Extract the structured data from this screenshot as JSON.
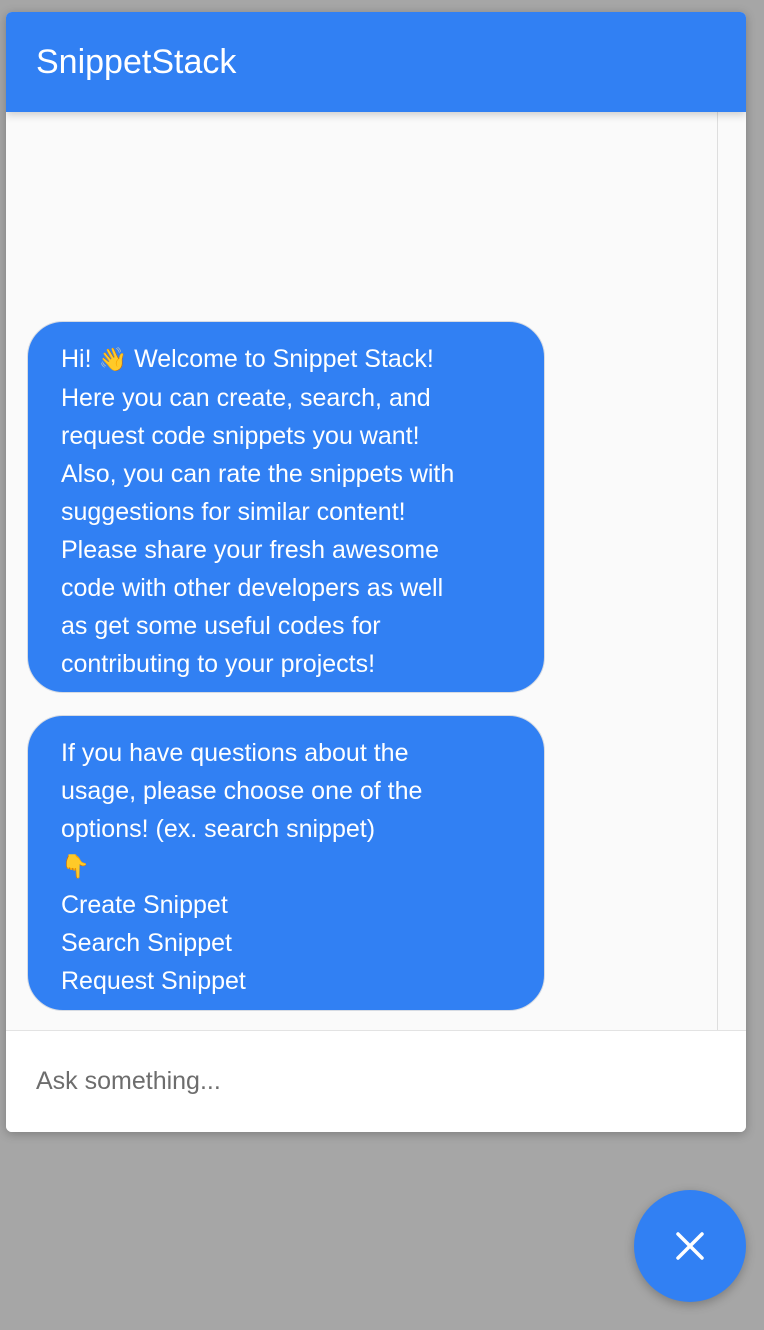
{
  "header": {
    "title": "SnippetStack"
  },
  "messages": [
    {
      "lines": [
        {
          "prefix": "Hi! ",
          "emoji": "👋",
          "suffix": " Welcome to Snippet Stack!"
        },
        {
          "text": "Here you can create, search, and"
        },
        {
          "text": "request code snippets you want!"
        },
        {
          "text": "Also, you can rate the snippets with"
        },
        {
          "text": "suggestions for similar content!"
        },
        {
          "text": "Please share your fresh awesome"
        },
        {
          "text": "code with other developers as well"
        },
        {
          "text": "as get some useful codes for"
        },
        {
          "text": "contributing to your projects!"
        }
      ]
    },
    {
      "lines": [
        {
          "text": "If you have questions about the"
        },
        {
          "text": "usage, please choose one of the"
        },
        {
          "text": "options! (ex. search snippet)"
        },
        {
          "emoji": "👇"
        }
      ],
      "options": [
        "Create Snippet",
        "Search Snippet",
        "Request Snippet"
      ]
    }
  ],
  "input": {
    "placeholder": "Ask something..."
  },
  "fab": {
    "icon": "close-icon"
  },
  "colors": {
    "accent": "#3180f3",
    "backdrop": "#a6a6a6",
    "panel": "#fafafa"
  }
}
